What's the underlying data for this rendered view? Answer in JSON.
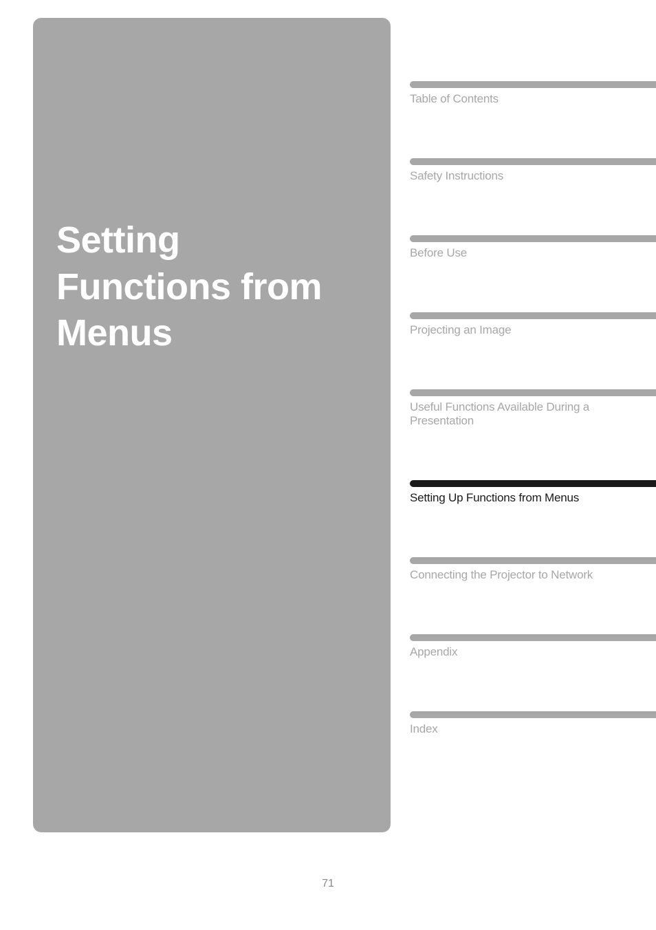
{
  "panel": {
    "title_line1": "Setting",
    "title_line2": "Functions from",
    "title_line3": "Menus"
  },
  "toc": {
    "items": [
      {
        "label": "Table of Contents",
        "active": false
      },
      {
        "label": "Safety Instructions",
        "active": false
      },
      {
        "label": "Before Use",
        "active": false
      },
      {
        "label": "Projecting an Image",
        "active": false
      },
      {
        "label": "Useful Functions Available During a Presentation",
        "active": false
      },
      {
        "label": "Setting Up Functions from Menus",
        "active": true
      },
      {
        "label": "Connecting the Projector to Network",
        "active": false
      },
      {
        "label": "Appendix",
        "active": false
      },
      {
        "label": "Index",
        "active": false
      }
    ]
  },
  "page_number": "71"
}
